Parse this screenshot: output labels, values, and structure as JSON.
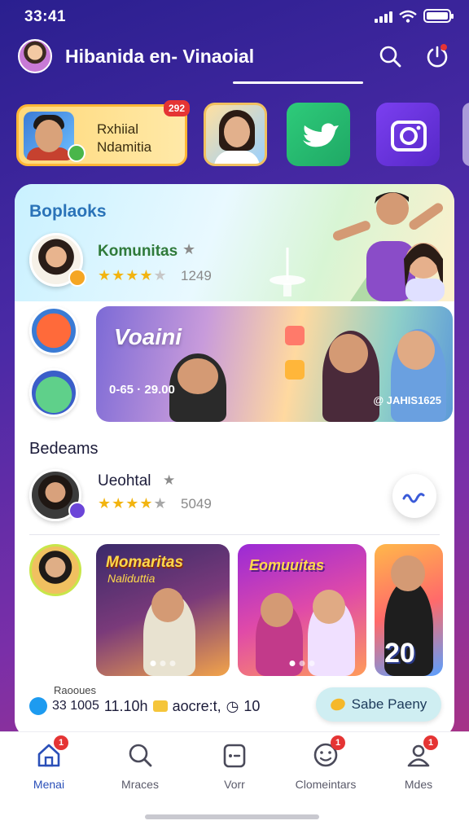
{
  "status_bar": {
    "time": "33:41"
  },
  "header": {
    "title": "Hibanida en- Vinaoial"
  },
  "stories": {
    "card": {
      "line1": "Rxhiial",
      "line2": "Ndamitia",
      "badge": "292"
    }
  },
  "feed": {
    "section1_title": "Boplaoks",
    "profile": {
      "name": "Komunitas",
      "rating": 4,
      "count": "1249"
    },
    "banner": {
      "title": "Voaini",
      "left_text": "0-65 · 29.00",
      "right_text": "@ JAHIS1625"
    },
    "section2_title": "Bedeams",
    "profile2": {
      "name": "Ueohtal",
      "rating": 4,
      "count": "5049"
    },
    "media": [
      {
        "title": "Momaritas",
        "subtitle": "Naliduttia"
      },
      {
        "title": "Eomuuitas"
      },
      {
        "big": "20"
      }
    ],
    "footer_label": "Raooues",
    "footer_info": {
      "codes": "33 1005",
      "time": "11.10h",
      "text": "aocre:t,",
      "count": "10"
    },
    "save_label": "Sabe Paeny"
  },
  "nav": {
    "items": [
      {
        "label": "Menai",
        "icon": "home-icon",
        "badge": "1"
      },
      {
        "label": "Mraces",
        "icon": "search-icon"
      },
      {
        "label": "Vorr",
        "icon": "box-icon"
      },
      {
        "label": "Clomeintars",
        "icon": "emoji-icon",
        "badge": "1"
      },
      {
        "label": "Mdes",
        "icon": "profile-icon",
        "badge": "1"
      }
    ]
  },
  "colors": {
    "accent": "#2a4fb8",
    "badge": "#e53434",
    "star": "#f2b410",
    "brand_gradient": "#4b2aa6"
  }
}
